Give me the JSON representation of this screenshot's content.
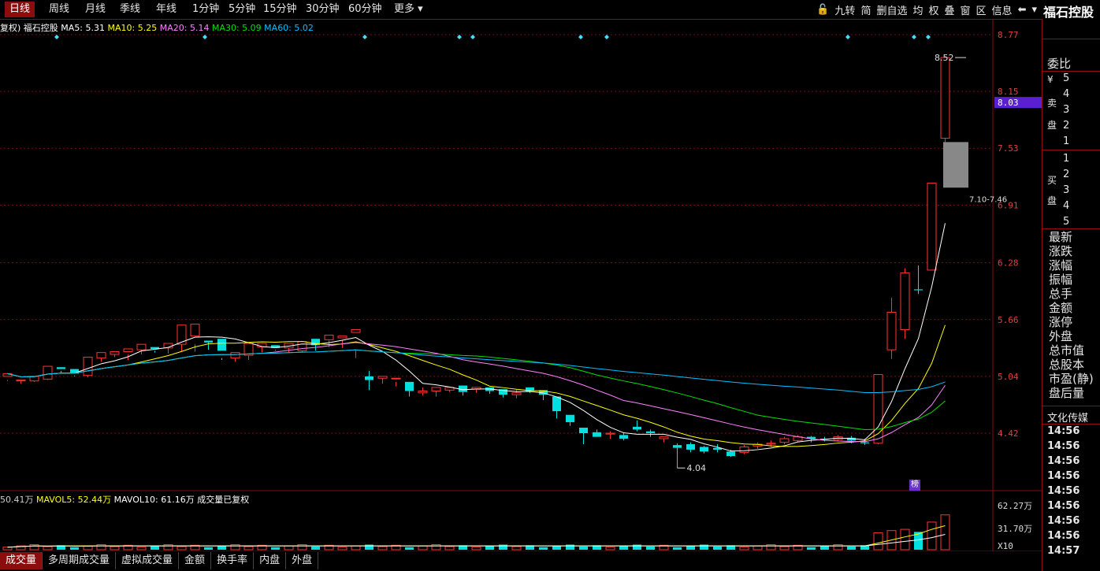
{
  "period_tabs": [
    {
      "label": "日线",
      "active": true
    },
    {
      "label": "周线"
    },
    {
      "label": "月线"
    },
    {
      "label": "季线"
    },
    {
      "label": "年线"
    },
    {
      "label": "1分钟"
    },
    {
      "label": "5分钟"
    },
    {
      "label": "15分钟"
    },
    {
      "label": "30分钟"
    },
    {
      "label": "60分钟"
    },
    {
      "label": "更多 ▾"
    }
  ],
  "toolbar": [
    "🔓",
    "九转",
    "简",
    "删自选",
    "均",
    "权",
    "叠",
    "窗",
    "区",
    "信息",
    "⬅",
    "▾"
  ],
  "stock_name": "福石控股",
  "header": {
    "prefix": "复权) 福石控股",
    "ma": [
      {
        "label": "MA5:",
        "value": "5.31",
        "color": "#ffffff"
      },
      {
        "label": "MA10:",
        "value": "5.25",
        "color": "#ffff00"
      },
      {
        "label": "MA20:",
        "value": "5.14",
        "color": "#ff80ff"
      },
      {
        "label": "MA30:",
        "value": "5.09",
        "color": "#00e000"
      },
      {
        "label": "MA60:",
        "value": "5.02",
        "color": "#00c0ff"
      }
    ]
  },
  "vol_header": {
    "items": [
      {
        "text": "50.41万",
        "color": "#cccccc"
      },
      {
        "text": "MAVOL5: 52.44万",
        "color": "#ffff00"
      },
      {
        "text": "MAVOL10: 61.16万",
        "color": "#ffffff"
      },
      {
        "text": "成交量已复权",
        "color": "#ffffff"
      }
    ]
  },
  "price_labels": [
    "8.77",
    "8.15",
    "7.53",
    "6.91",
    "6.28",
    "5.66",
    "5.04",
    "4.42"
  ],
  "current_price": "8.03",
  "annotations": {
    "high": "8.52",
    "low": "4.04",
    "gap": "7.10-7.46"
  },
  "vol_labels": [
    "62.27万",
    "31.70万",
    "X10"
  ],
  "bottom_tabs": [
    "成交量",
    "多周期成交量",
    "虚拟成交量",
    "金额",
    "换手率",
    "内盘",
    "外盘"
  ],
  "right_panel": {
    "weibi": "委比",
    "sell_label": [
      "¥",
      "卖",
      "盘"
    ],
    "sell_levels": [
      "5",
      "4",
      "3",
      "2",
      "1"
    ],
    "buy_label": [
      "买",
      "盘"
    ],
    "buy_levels": [
      "1",
      "2",
      "3",
      "4",
      "5"
    ],
    "fields": [
      "最新",
      "涨跌",
      "涨幅",
      "振幅",
      "总手",
      "金额",
      "涨停",
      "外盘",
      "总市值",
      "总股本",
      "市盈(静)",
      "盘后量"
    ],
    "news": "文化传媒",
    "times": [
      "14:56",
      "14:56",
      "14:56",
      "14:56",
      "14:56",
      "14:56",
      "14:56",
      "14:56",
      "14:57"
    ]
  },
  "bang_tag": "榜",
  "chart_data": {
    "type": "candlestick",
    "price_axis": [
      4.04,
      8.77
    ],
    "candles": [
      [
        5.04,
        5.07,
        4.99,
        5.0
      ],
      [
        4.99,
        5.0,
        4.96,
        4.99
      ],
      [
        4.99,
        5.04,
        4.98,
        5.02
      ],
      [
        5.01,
        5.15,
        5.0,
        5.13
      ],
      [
        5.14,
        5.12,
        5.08,
        5.1
      ],
      [
        5.12,
        5.07,
        5.04,
        5.05
      ],
      [
        5.05,
        5.25,
        5.03,
        5.24
      ],
      [
        5.24,
        5.3,
        5.2,
        5.28
      ],
      [
        5.28,
        5.31,
        5.25,
        5.3
      ],
      [
        5.31,
        5.34,
        5.22,
        5.28
      ],
      [
        5.33,
        5.39,
        5.28,
        5.36
      ],
      [
        5.36,
        5.34,
        5.3,
        5.32
      ],
      [
        5.35,
        5.4,
        5.29,
        5.38
      ],
      [
        5.39,
        5.6,
        5.31,
        5.48
      ],
      [
        5.48,
        5.61,
        5.31,
        5.39
      ],
      [
        5.43,
        5.41,
        5.33,
        5.42
      ],
      [
        5.45,
        5.32,
        5.22,
        5.24
      ],
      [
        5.24,
        5.3,
        5.2,
        5.26
      ],
      [
        5.27,
        5.4,
        5.22,
        5.36
      ],
      [
        5.36,
        5.4,
        5.3,
        5.38
      ],
      [
        5.38,
        5.35,
        5.32,
        5.33
      ],
      [
        5.35,
        5.4,
        5.3,
        5.38
      ],
      [
        5.32,
        5.42,
        5.3,
        5.4
      ],
      [
        5.45,
        5.38,
        5.32,
        5.41
      ],
      [
        5.44,
        5.49,
        5.36,
        5.43
      ],
      [
        5.46,
        5.48,
        5.35,
        5.44
      ],
      [
        5.52,
        5.55,
        5.24,
        5.32
      ],
      [
        5.04,
        5.0,
        4.89,
        5.1
      ],
      [
        5.02,
        5.04,
        4.96,
        5.04
      ],
      [
        5.02,
        5.02,
        4.93,
        4.98
      ],
      [
        4.98,
        4.88,
        4.82,
        4.91
      ],
      [
        4.86,
        4.88,
        4.83,
        4.92
      ],
      [
        4.88,
        4.92,
        4.82,
        4.88
      ],
      [
        4.89,
        4.92,
        4.87,
        4.9
      ],
      [
        4.94,
        4.87,
        4.83,
        4.91
      ],
      [
        4.9,
        4.92,
        4.86,
        4.91
      ],
      [
        4.92,
        4.88,
        4.85,
        4.89
      ],
      [
        4.9,
        4.84,
        4.81,
        4.86
      ],
      [
        4.84,
        4.86,
        4.8,
        4.9
      ],
      [
        4.92,
        4.88,
        4.86,
        4.9
      ],
      [
        4.89,
        4.84,
        4.78,
        4.86
      ],
      [
        4.82,
        4.66,
        4.58,
        4.72
      ],
      [
        4.62,
        4.54,
        4.5,
        4.56
      ],
      [
        4.48,
        4.42,
        4.3,
        4.46
      ],
      [
        4.43,
        4.38,
        4.4,
        4.46
      ],
      [
        4.41,
        4.42,
        4.36,
        4.44
      ],
      [
        4.4,
        4.36,
        4.34,
        4.42
      ],
      [
        4.49,
        4.46,
        4.44,
        4.56
      ],
      [
        4.44,
        4.42,
        4.38,
        4.46
      ],
      [
        4.36,
        4.38,
        4.32,
        4.38
      ],
      [
        4.29,
        4.26,
        4.04,
        4.31
      ],
      [
        4.3,
        4.24,
        4.21,
        4.32
      ],
      [
        4.27,
        4.22,
        4.2,
        4.28
      ],
      [
        4.26,
        4.24,
        4.21,
        4.3
      ],
      [
        4.22,
        4.17,
        4.16,
        4.24
      ],
      [
        4.21,
        4.27,
        4.19,
        4.29
      ],
      [
        4.28,
        4.3,
        4.25,
        4.32
      ],
      [
        4.3,
        4.31,
        4.27,
        4.34
      ],
      [
        4.32,
        4.36,
        4.3,
        4.38
      ],
      [
        4.34,
        4.38,
        4.32,
        4.4
      ],
      [
        4.38,
        4.36,
        4.32,
        4.39
      ],
      [
        4.36,
        4.35,
        4.33,
        4.38
      ],
      [
        4.35,
        4.38,
        4.33,
        4.4
      ],
      [
        4.37,
        4.34,
        4.31,
        4.39
      ],
      [
        4.32,
        4.31,
        4.29,
        4.36
      ],
      [
        4.31,
        5.06,
        4.3,
        5.06
      ],
      [
        5.33,
        5.74,
        5.23,
        5.9
      ],
      [
        5.55,
        6.17,
        5.45,
        6.22
      ],
      [
        5.99,
        5.98,
        5.94,
        6.25
      ],
      [
        6.2,
        7.15,
        6.2,
        7.15
      ],
      [
        7.64,
        8.52,
        7.5,
        8.52
      ]
    ]
  }
}
